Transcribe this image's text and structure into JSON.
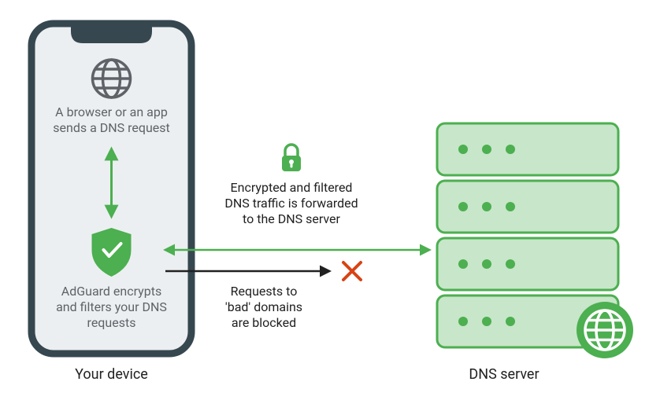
{
  "colors": {
    "phone_stroke": "#37474f",
    "phone_fill": "#eceff1",
    "green": "#4caf50",
    "green_fill": "#c8e6c9",
    "grey": "#5f6368",
    "red": "#d84315",
    "black": "#212121"
  },
  "phone": {
    "browser_text_l1": "A browser or an app",
    "browser_text_l2": "sends a DNS request",
    "adguard_text_l1": "AdGuard encrypts",
    "adguard_text_l2": "and filters your DNS",
    "adguard_text_l3": "requests"
  },
  "middle": {
    "encrypted_l1": "Encrypted and filtered",
    "encrypted_l2": "DNS traffic is forwarded",
    "encrypted_l3": "to the DNS server",
    "blocked_l1": "Requests to",
    "blocked_l2": "'bad' domains",
    "blocked_l3": "are blocked"
  },
  "captions": {
    "device": "Your device",
    "server": "DNS server"
  }
}
